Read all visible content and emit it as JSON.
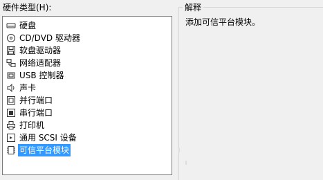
{
  "hardware": {
    "label": "硬件类型(H):",
    "items": [
      {
        "label": "硬盘",
        "icon": "hard-disk-icon"
      },
      {
        "label": "CD/DVD 驱动器",
        "icon": "cd-dvd-icon"
      },
      {
        "label": "软盘驱动器",
        "icon": "floppy-icon"
      },
      {
        "label": "网络适配器",
        "icon": "network-icon"
      },
      {
        "label": "USB 控制器",
        "icon": "usb-icon"
      },
      {
        "label": "声卡",
        "icon": "speaker-icon"
      },
      {
        "label": "并行端口",
        "icon": "parallel-port-icon"
      },
      {
        "label": "串行端口",
        "icon": "serial-port-icon"
      },
      {
        "label": "打印机",
        "icon": "printer-icon"
      },
      {
        "label": "通用 SCSI 设备",
        "icon": "scsi-icon"
      },
      {
        "label": "可信平台模块",
        "icon": "tpm-icon",
        "selected": true
      }
    ]
  },
  "explanation": {
    "title": "解释",
    "text": "添加可信平台模块。"
  },
  "colors": {
    "selection": "#3399ff",
    "background": "#f0f0f0"
  }
}
